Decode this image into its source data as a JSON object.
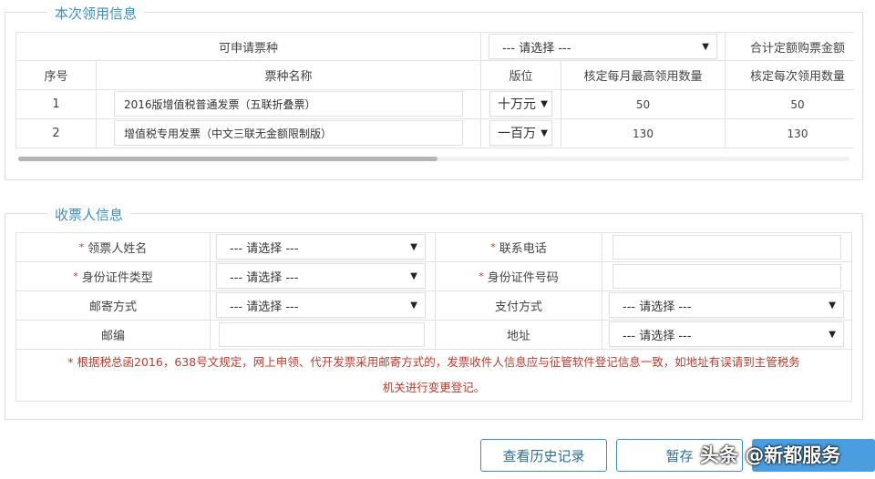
{
  "section1": {
    "legend": "本次领用信息",
    "header_group": "可申请票种",
    "group_select": "--- 请选择 ---",
    "total_header": "合计定额购票金额",
    "columns": [
      "序号",
      "票种名称",
      "版位",
      "核定每月最高领用数量",
      "核定每次领用数量"
    ],
    "rows": [
      {
        "index": "1",
        "name": "2016版增值税普通发票（五联折叠票）",
        "denomination": "十万元",
        "monthly_max": "50",
        "per_time": "50"
      },
      {
        "index": "2",
        "name": "增值税专用发票（中文三联无金额限制版）",
        "denomination": "一百万",
        "monthly_max": "130",
        "per_time": "130"
      }
    ]
  },
  "section2": {
    "legend": "收票人信息",
    "required_mark": "*",
    "fields": {
      "recipient_name": {
        "label": "领票人姓名",
        "value": "--- 请选择 ---"
      },
      "phone": {
        "label": "联系电话",
        "value": ""
      },
      "id_type": {
        "label": "身份证件类型",
        "value": "--- 请选择 ---"
      },
      "id_number": {
        "label": "身份证件号码",
        "value": ""
      },
      "mail_method": {
        "label": "邮寄方式",
        "value": "--- 请选择 ---"
      },
      "payment_method": {
        "label": "支付方式",
        "value": "--- 请选择 ---"
      },
      "postcode": {
        "label": "邮编",
        "value": ""
      },
      "address": {
        "label": "地址",
        "value": "--- 请选择 ---"
      }
    },
    "notice_line1": "* 根据税总函2016，638号文规定，网上申领、代开发票采用邮寄方式的，发票收件人信息应与征管软件登记信息一致，如地址有误请到主管税务",
    "notice_line2": "机关进行变更登记。"
  },
  "buttons": {
    "history": "查看历史记录",
    "save_draft": "暂存"
  },
  "watermark": "头条 @新都服务",
  "arrow": "▼",
  "colors": {
    "accent": "#3a8fc7",
    "notice": "#c0392b",
    "primary_button": "#4a9ee0"
  }
}
